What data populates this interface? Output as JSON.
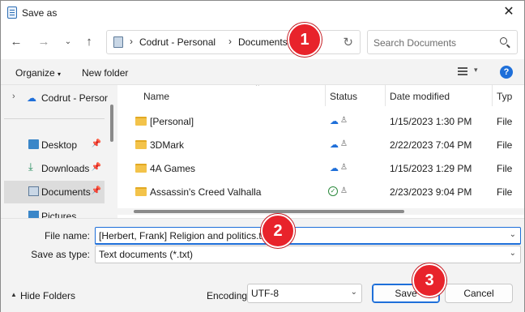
{
  "window": {
    "title": "Save as",
    "close_icon": "close-icon"
  },
  "nav": {
    "back_icon": "arrow-left-icon",
    "forward_icon": "arrow-right-icon",
    "recent_icon": "chevron-down-icon",
    "up_icon": "arrow-up-icon",
    "breadcrumbs": [
      "Codrut - Personal",
      "Documents"
    ],
    "refresh_icon": "refresh-icon",
    "search_placeholder": "Search Documents"
  },
  "toolbar": {
    "organize_label": "Organize",
    "new_folder_label": "New folder",
    "help_label": "?"
  },
  "sidebar": {
    "items": [
      {
        "label": "Codrut - Persona",
        "icon": "cloud-icon"
      },
      {
        "label": "Desktop",
        "icon": "desktop-icon",
        "pinned": true
      },
      {
        "label": "Downloads",
        "icon": "download-icon",
        "pinned": true
      },
      {
        "label": "Documents",
        "icon": "documents-icon",
        "pinned": true,
        "selected": true
      },
      {
        "label": "Pictures",
        "icon": "pictures-icon",
        "pinned": true
      }
    ]
  },
  "files": {
    "columns": {
      "name": "Name",
      "status": "Status",
      "date": "Date modified",
      "type": "Typ"
    },
    "rows": [
      {
        "name": "[Personal]",
        "status": "cloud",
        "date": "1/15/2023 1:30 PM",
        "type": "File"
      },
      {
        "name": "3DMark",
        "status": "cloud",
        "date": "2/22/2023 7:04 PM",
        "type": "File"
      },
      {
        "name": "4A Games",
        "status": "cloud",
        "date": "1/15/2023 1:29 PM",
        "type": "File"
      },
      {
        "name": "Assassin's Creed Valhalla",
        "status": "synced",
        "date": "2/23/2023 9:04 PM",
        "type": "File"
      }
    ]
  },
  "form": {
    "file_name_label": "File name:",
    "file_name_value": "[Herbert, Frank] Religion and politics.txt",
    "save_type_label": "Save as type:",
    "save_type_value": "Text documents (*.txt)",
    "hide_folders_label": "Hide Folders",
    "encoding_label": "Encoding:",
    "encoding_value": "UTF-8",
    "save_label": "Save",
    "cancel_label": "Cancel"
  },
  "callouts": [
    "1",
    "2",
    "3"
  ],
  "colors": {
    "accent": "#1e6fd9",
    "callout": "#e8232b",
    "folder": "#f3c34a"
  }
}
